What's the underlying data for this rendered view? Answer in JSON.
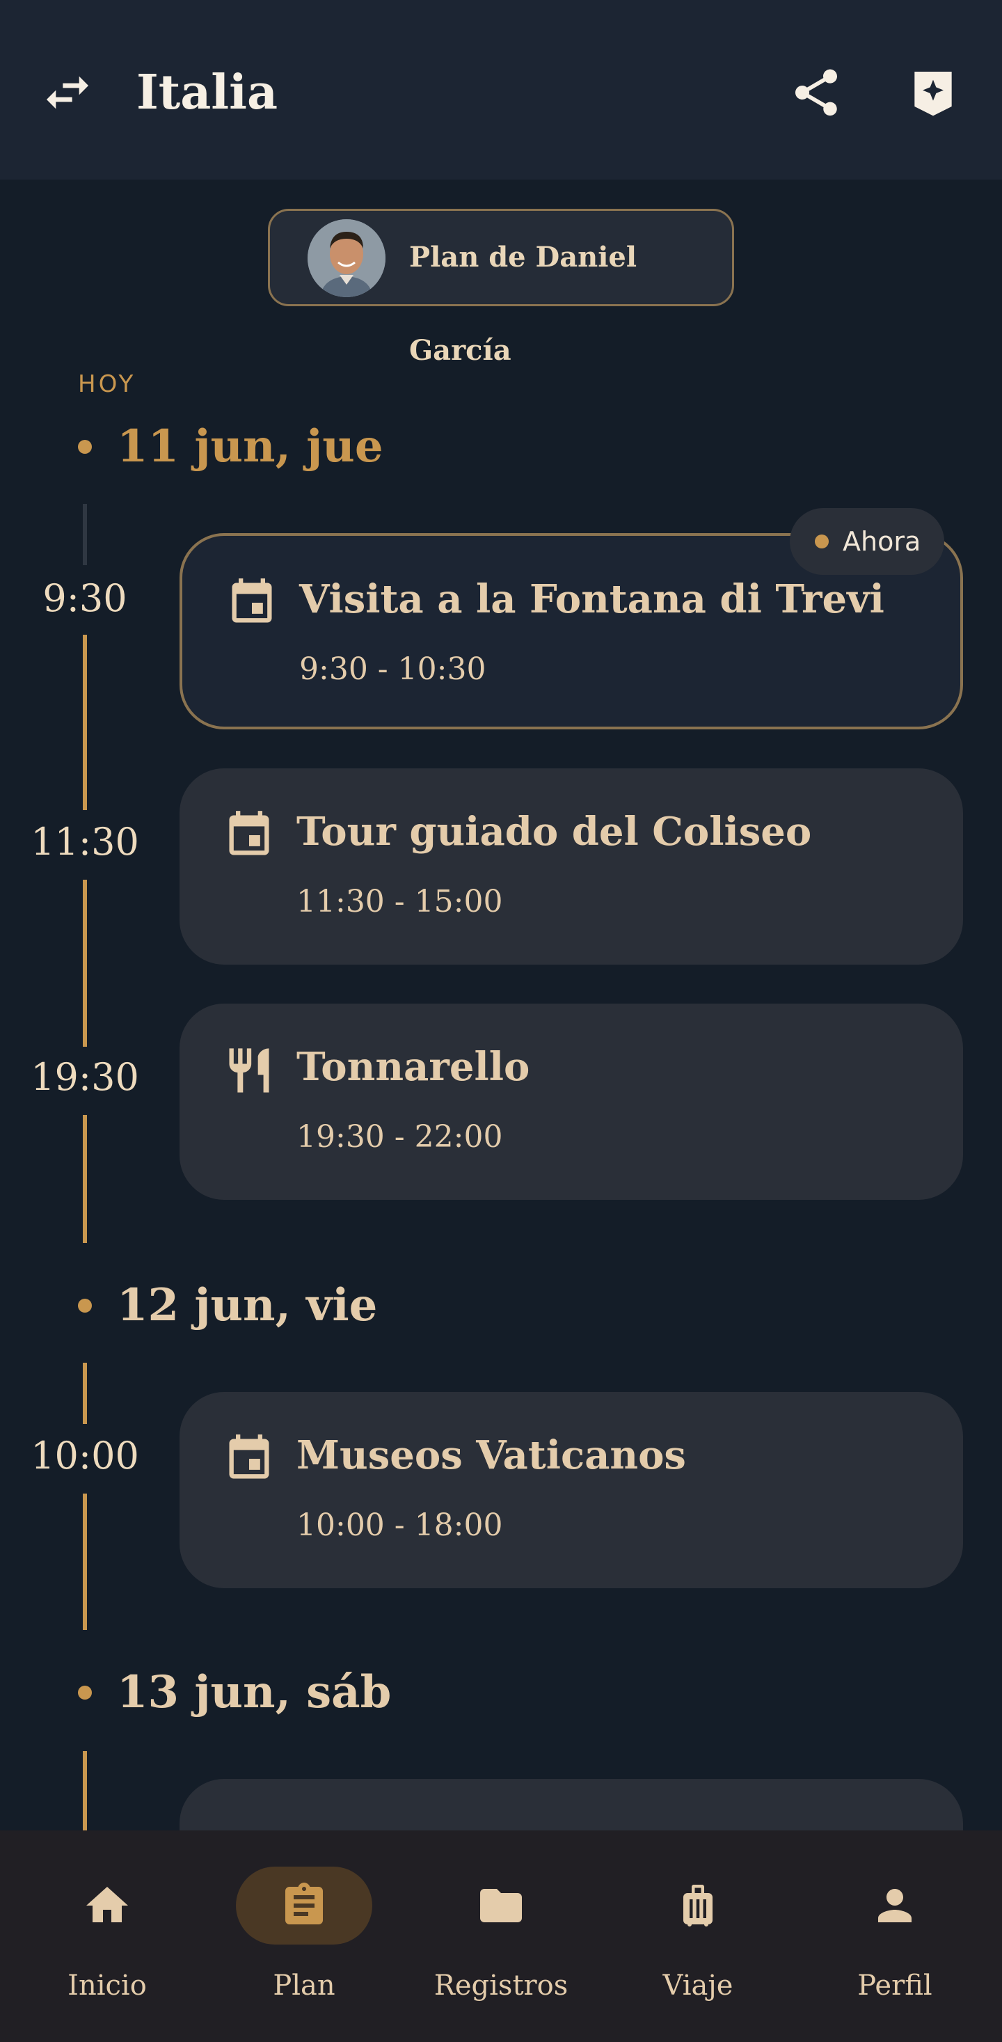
{
  "header": {
    "title": "Italia",
    "swap_icon": "swap-arrows-icon",
    "share_icon": "share-icon",
    "bookmark_icon": "bookmark-sparkle-icon"
  },
  "plan_owner": {
    "label": "Plan de Daniel García",
    "avatar_icon": "avatar"
  },
  "timeline": {
    "today_label": "HOY",
    "now_badge": "Ahora",
    "days": [
      {
        "title": "11 jun, jue",
        "events": [
          {
            "time": "9:30",
            "title": "Visita a la Fontana di Trevi",
            "range": "9:30 - 10:30",
            "icon": "calendar-icon",
            "current": true
          },
          {
            "time": "11:30",
            "title": "Tour guiado del Coliseo",
            "range": "11:30 - 15:00",
            "icon": "calendar-icon"
          },
          {
            "time": "19:30",
            "title": "Tonnarello",
            "range": "19:30 - 22:00",
            "icon": "restaurant-icon"
          }
        ]
      },
      {
        "title": "12 jun, vie",
        "events": [
          {
            "time": "10:00",
            "title": "Museos Vaticanos",
            "range": "10:00 - 18:00",
            "icon": "calendar-icon"
          }
        ]
      },
      {
        "title": "13 jun, sáb",
        "events": []
      }
    ]
  },
  "bottom_nav": {
    "items": [
      {
        "label": "Inicio",
        "icon": "home-icon"
      },
      {
        "label": "Plan",
        "icon": "clipboard-icon",
        "selected": true
      },
      {
        "label": "Registros",
        "icon": "folder-icon"
      },
      {
        "label": "Viaje",
        "icon": "luggage-icon"
      },
      {
        "label": "Perfil",
        "icon": "person-icon"
      }
    ]
  },
  "colors": {
    "background": "#141d28",
    "header": "#1c2533",
    "accent": "#c9974f",
    "text": "#e4ccab",
    "card": "#2a2f38",
    "nav": "#211f24"
  }
}
